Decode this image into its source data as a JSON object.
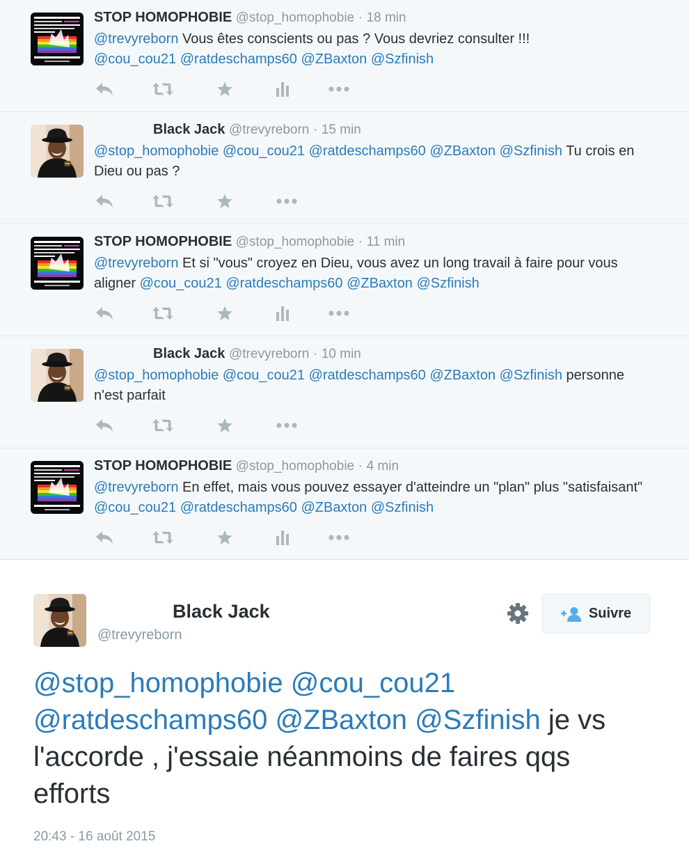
{
  "thread": [
    {
      "fullname": "STOP HOMOPHOBIE",
      "handle": "@stop_homophobie",
      "separator": "·",
      "time": "18 min",
      "mentions_lead": "@trevyreborn",
      "body": " Vous êtes conscients ou pas ? Vous devriez consulter !!!",
      "mentions_tail": [
        "@cou_cou21",
        "@ratdeschamps60",
        "@ZBaxton",
        "@Szfinish"
      ],
      "avatar_icon": "stop-homophobie-logo-icon"
    },
    {
      "fullname": "Black Jack",
      "handle": "@trevyreborn",
      "separator": "·",
      "time": "15 min",
      "mentions_lead": "@stop_homophobie @cou_cou21 @ratdeschamps60 @ZBaxton @Szfinish",
      "body": " Tu crois en Dieu ou pas ?",
      "avatar_icon": "black-jack-portrait-icon"
    },
    {
      "fullname": "STOP HOMOPHOBIE",
      "handle": "@stop_homophobie",
      "separator": "·",
      "time": "11 min",
      "mentions_lead": "@trevyreborn",
      "body": " Et si \"vous\" croyez en Dieu, vous avez un long travail à faire pour vous aligner",
      "mentions_tail": [
        "@cou_cou21",
        "@ratdeschamps60",
        "@ZBaxton",
        "@Szfinish"
      ],
      "avatar_icon": "stop-homophobie-logo-icon"
    },
    {
      "fullname": "Black Jack",
      "handle": "@trevyreborn",
      "separator": "·",
      "time": "10 min",
      "mentions_lead": "@stop_homophobie @cou_cou21 @ratdeschamps60 @ZBaxton @Szfinish",
      "body": " personne n'est parfait",
      "avatar_icon": "black-jack-portrait-icon"
    },
    {
      "fullname": "STOP HOMOPHOBIE",
      "handle": "@stop_homophobie",
      "separator": "·",
      "time": "4 min",
      "mentions_lead": "@trevyreborn",
      "body": " En effet, mais vous pouvez essayer d'atteindre un \"plan\" plus \"satisfaisant\"",
      "mentions_tail": [
        "@cou_cou21",
        "@ratdeschamps60",
        "@ZBaxton",
        "@Szfinish"
      ],
      "avatar_icon": "stop-homophobie-logo-icon"
    }
  ],
  "main_tweet": {
    "fullname": "Black Jack",
    "handle": "@trevyreborn",
    "follow_label": "Suivre",
    "mentions": "@stop_homophobie @cou_cou21 @ratdeschamps60 @ZBaxton @Szfinish",
    "body": " je vs l'accorde , j'essaie néanmoins de faires qqs efforts",
    "date": "20:43 - 16 août 2015"
  },
  "colors": {
    "link": "#2b7bb9",
    "muted": "#8899a6",
    "icon": "#aab8c2",
    "text": "#292f33",
    "thread_bg": "#f5f8fa"
  },
  "icons": [
    "reply-icon",
    "retweet-icon",
    "favorite-icon",
    "analytics-icon",
    "more-icon",
    "gear-icon",
    "follow-person-icon"
  ]
}
